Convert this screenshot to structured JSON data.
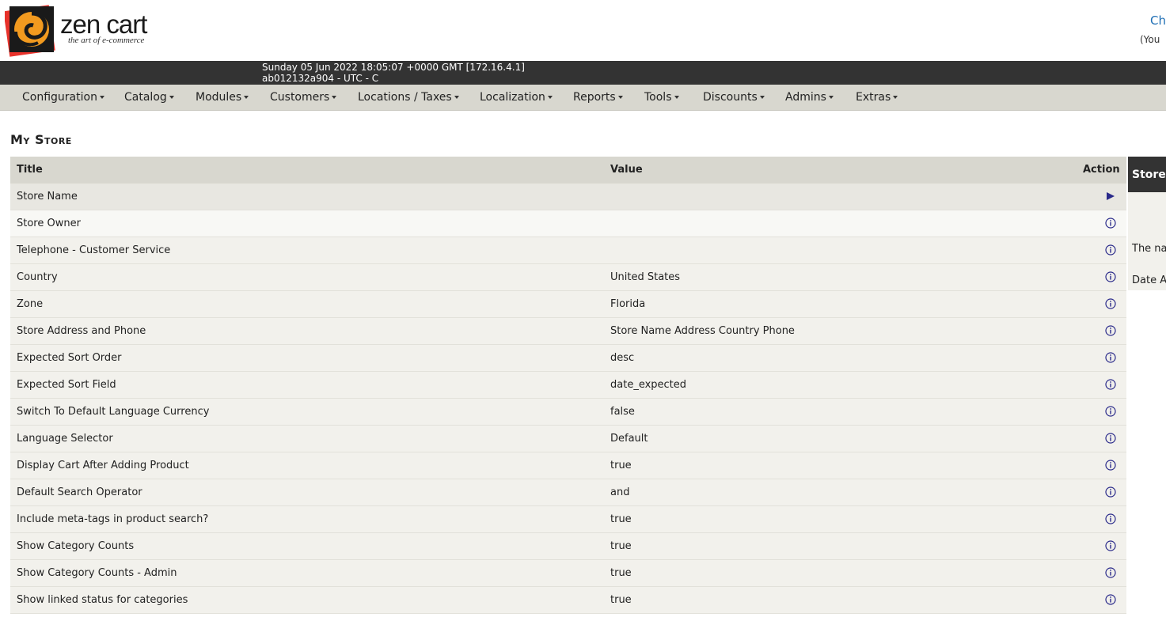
{
  "header": {
    "logo_word": "zen cart",
    "logo_tagline": "the art of e-commerce",
    "top_right_link": "Ch",
    "top_right_note": "(You"
  },
  "infobar": {
    "line1": "Sunday 05 Jun 2022 18:05:07 +0000 GMT [172.16.4.1]",
    "line2": "ab012132a904 - UTC - C"
  },
  "menu": [
    "Configuration",
    "Catalog",
    "Modules",
    "Customers",
    "Locations / Taxes",
    "Localization",
    "Reports",
    "Tools",
    "Discounts",
    "Admins",
    "Extras"
  ],
  "page_title": "My Store",
  "table": {
    "headers": {
      "title": "Title",
      "value": "Value",
      "action": "Action"
    },
    "rows": [
      {
        "title": "Store Name",
        "value": "",
        "action": "play-arrow-icon"
      },
      {
        "title": "Store Owner",
        "value": "",
        "action": "info-icon"
      },
      {
        "title": "Telephone - Customer Service",
        "value": "",
        "action": "info-icon"
      },
      {
        "title": "Country",
        "value": "United States",
        "action": "info-icon"
      },
      {
        "title": "Zone",
        "value": "Florida",
        "action": "info-icon"
      },
      {
        "title": "Store Address and Phone",
        "value": "Store Name Address Country Phone",
        "action": "info-icon"
      },
      {
        "title": "Expected Sort Order",
        "value": "desc",
        "action": "info-icon"
      },
      {
        "title": "Expected Sort Field",
        "value": "date_expected",
        "action": "info-icon"
      },
      {
        "title": "Switch To Default Language Currency",
        "value": "false",
        "action": "info-icon"
      },
      {
        "title": "Language Selector",
        "value": "Default",
        "action": "info-icon"
      },
      {
        "title": "Display Cart After Adding Product",
        "value": "true",
        "action": "info-icon"
      },
      {
        "title": "Default Search Operator",
        "value": "and",
        "action": "info-icon"
      },
      {
        "title": "Include meta-tags in product search?",
        "value": "true",
        "action": "info-icon"
      },
      {
        "title": "Show Category Counts",
        "value": "true",
        "action": "info-icon"
      },
      {
        "title": "Show Category Counts - Admin",
        "value": "true",
        "action": "info-icon"
      },
      {
        "title": "Show linked status for categories",
        "value": "true",
        "action": "info-icon"
      }
    ]
  },
  "side_panel": {
    "heading": "Store",
    "line1": "The nar",
    "line2": "Date Ac"
  },
  "colors": {
    "infobar": "#333333",
    "menubar": "#d8d7cf",
    "row": "#f2f1ec",
    "link": "#1f6fb5",
    "action_icon": "#2a2a8a"
  }
}
